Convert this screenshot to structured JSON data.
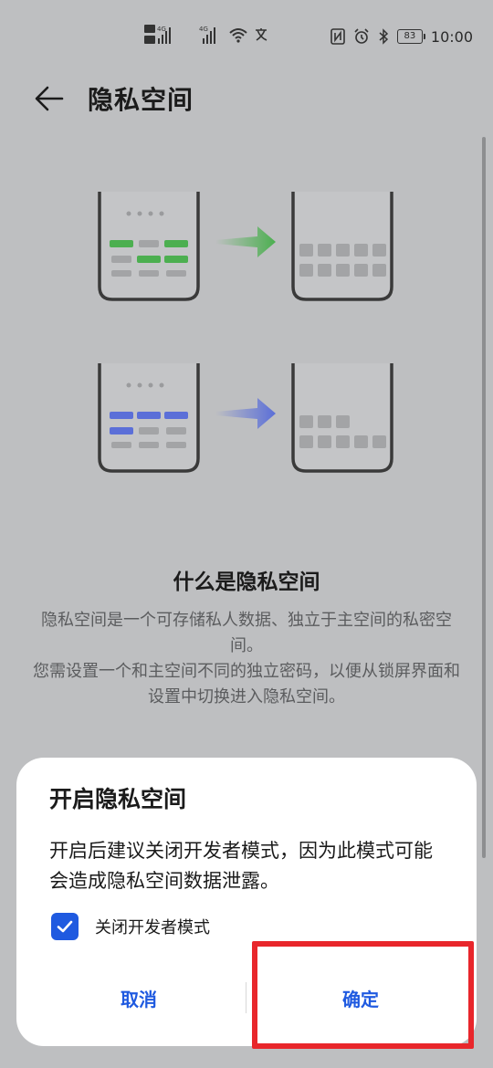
{
  "status_bar": {
    "time": "10:00",
    "battery": "83",
    "left_icons": [
      "hd-icon",
      "signal-icon",
      "hd-icon",
      "signal-icon",
      "wifi-icon",
      "translate-icon"
    ],
    "right_icons": [
      "nfc-icon",
      "alarm-icon",
      "bluetooth-icon",
      "battery-icon"
    ]
  },
  "header": {
    "title": "隐私空间"
  },
  "illustration": {
    "accent_green": "#4caf50",
    "accent_blue": "#5b6fd8"
  },
  "info": {
    "title": "什么是隐私空间",
    "paragraphs": [
      "隐私空间是一个可存储私人数据、独立于主空间的私密空间。",
      "您需设置一个和主空间不同的独立密码，以便从锁屏界面和设置中切换进入隐私空间。"
    ]
  },
  "dialog": {
    "title": "开启隐私空间",
    "message": "开启后建议关闭开发者模式，因为此模式可能会造成隐私空间数据泄露。",
    "checkbox_label": "关闭开发者模式",
    "checkbox_checked": true,
    "cancel_label": "取消",
    "confirm_label": "确定"
  },
  "colors": {
    "accent": "#1f5ae0",
    "highlight": "#e8262b"
  }
}
